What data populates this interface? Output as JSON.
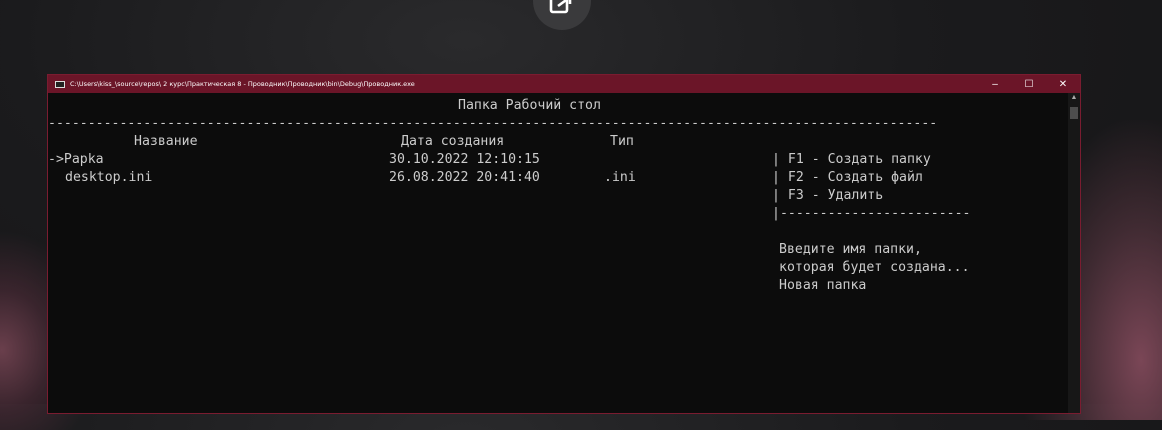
{
  "window": {
    "title": "C:\\Users\\kiss_\\source\\repos\\ 2 курс\\Практическая 8 - Проводник\\Проводник\\bin\\Debug\\Проводник.exe",
    "minimize_label": "–",
    "maximize_label": "☐",
    "close_label": "✕"
  },
  "console": {
    "heading": "Папка Рабочий стол",
    "separator": "----------------------------------------------------------------------------------------------------------------",
    "columns": {
      "name": "Название",
      "date": "Дата создания",
      "type": "Тип"
    },
    "rows": [
      {
        "name": "->Papka",
        "date": "30.10.2022 12:10:15",
        "type": ""
      },
      {
        "name": "desktop.ini",
        "date": "26.08.2022 20:41:40",
        "type": ".ini"
      }
    ],
    "menu": [
      "| F1 - Создать папку",
      "| F2 - Создать файл",
      "| F3 - Удалить",
      "|------------------------"
    ],
    "prompt_lines": [
      "Введите имя папки,",
      "которая будет создана...",
      "Новая папка"
    ]
  },
  "icons": {
    "floating_button": "popout-icon",
    "app": "console-app-icon"
  }
}
